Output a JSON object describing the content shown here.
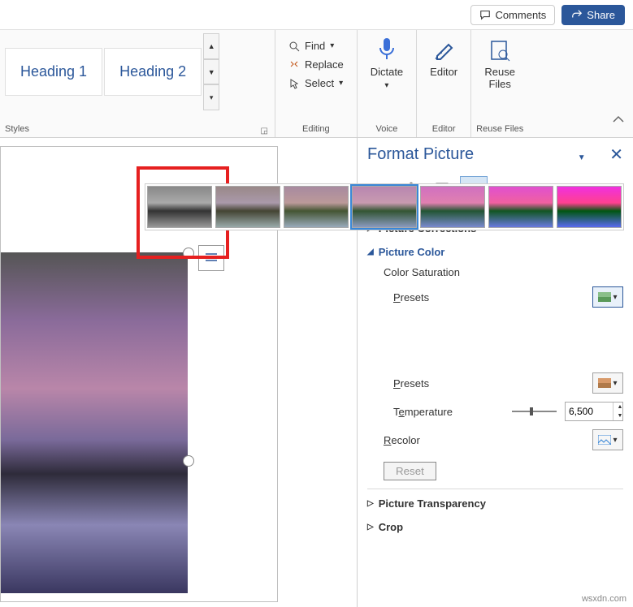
{
  "titlebar": {
    "comments": "Comments",
    "share": "Share"
  },
  "ribbon": {
    "styles": {
      "items": [
        "Heading 1",
        "Heading 2"
      ],
      "label": "Styles"
    },
    "editing": {
      "find": "Find",
      "replace": "Replace",
      "select": "Select",
      "label": "Editing"
    },
    "dictate": {
      "label": "Dictate",
      "group": "Voice"
    },
    "editor": {
      "label": "Editor",
      "group": "Editor"
    },
    "reuse": {
      "label": "Reuse\nFiles",
      "group": "Reuse Files"
    }
  },
  "pane": {
    "title": "Format Picture",
    "sections": {
      "corrections": "Picture Corrections",
      "color": "Picture Color",
      "saturation": "Color Saturation",
      "presets": "Presets",
      "temperature": "Temperature",
      "temp_presets": "Presets",
      "temp_value": "6,500",
      "recolor": "Recolor",
      "reset": "Reset",
      "transparency": "Picture Transparency",
      "crop": "Crop"
    }
  },
  "watermark": "wsxdn.com"
}
